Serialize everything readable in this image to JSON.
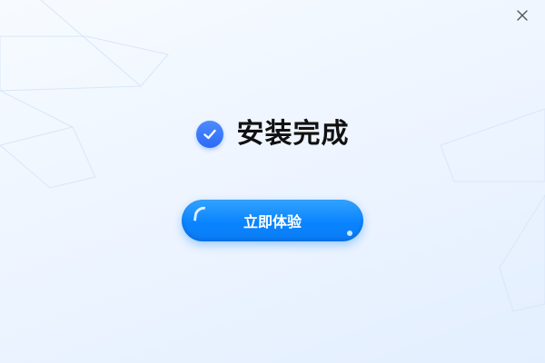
{
  "window": {
    "close_icon": "close-icon"
  },
  "status": {
    "icon": "check-circle-icon",
    "title": "安装完成"
  },
  "action": {
    "label": "立即体验"
  },
  "colors": {
    "accent": "#0a84ff",
    "check": "#2b6af5",
    "title_text": "#111111",
    "background": "#eef5ff"
  }
}
